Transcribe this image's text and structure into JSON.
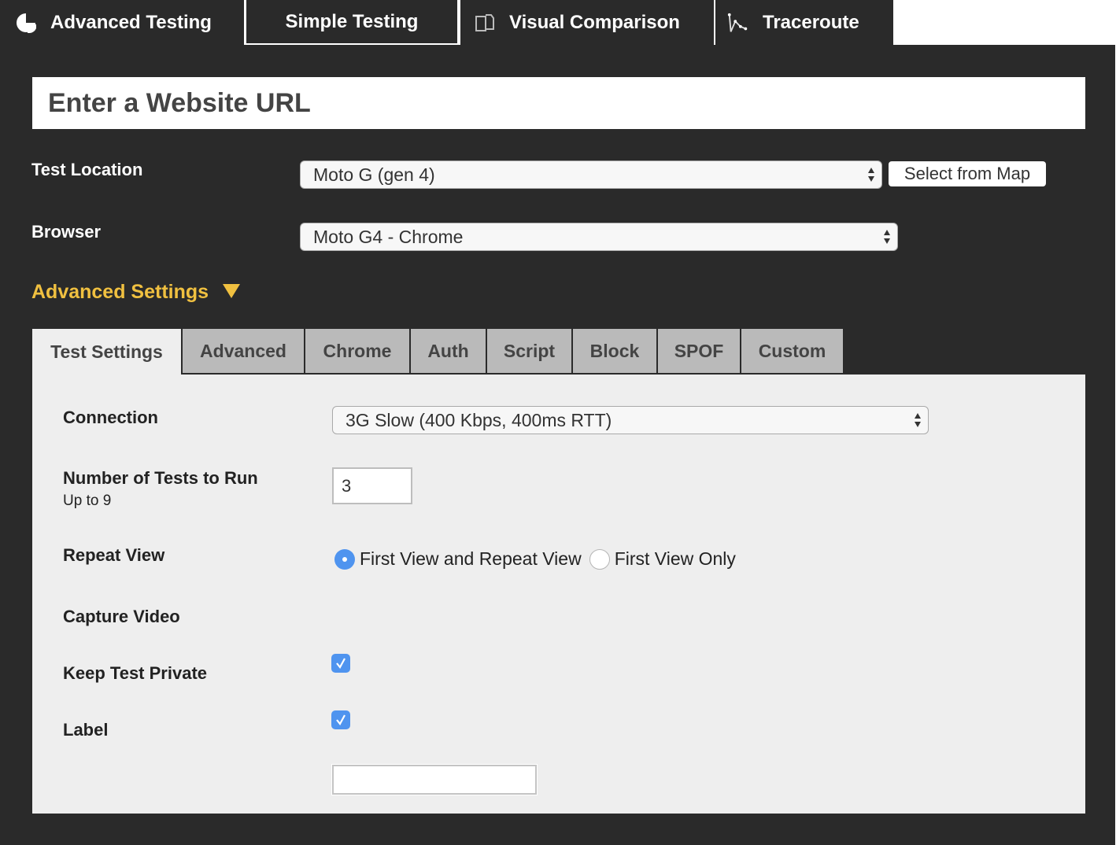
{
  "nav": {
    "tabs": [
      {
        "label": "Advanced Testing",
        "icon": "webpagetest-logo-icon",
        "active": true
      },
      {
        "label": "Simple Testing",
        "icon": null,
        "active": false
      },
      {
        "label": "Visual Comparison",
        "icon": "pages-icon",
        "active": false
      },
      {
        "label": "Traceroute",
        "icon": "traceroute-icon",
        "active": false
      }
    ]
  },
  "url": {
    "placeholder": "Enter a Website URL",
    "value": ""
  },
  "test_location": {
    "label": "Test Location",
    "selected": "Moto G (gen 4)",
    "map_button": "Select from Map"
  },
  "browser": {
    "label": "Browser",
    "selected": "Moto G4 - Chrome"
  },
  "advanced_settings": {
    "label": "Advanced Settings",
    "expanded": true,
    "accent_color": "#f0c040"
  },
  "settings_tabs": [
    {
      "label": "Test Settings",
      "active": true
    },
    {
      "label": "Advanced",
      "active": false
    },
    {
      "label": "Chrome",
      "active": false
    },
    {
      "label": "Auth",
      "active": false
    },
    {
      "label": "Script",
      "active": false
    },
    {
      "label": "Block",
      "active": false
    },
    {
      "label": "SPOF",
      "active": false
    },
    {
      "label": "Custom",
      "active": false
    }
  ],
  "test_settings": {
    "connection": {
      "label": "Connection",
      "selected": "3G Slow (400 Kbps, 400ms RTT)"
    },
    "num_tests": {
      "label": "Number of Tests to Run",
      "hint": "Up to 9",
      "value": "3"
    },
    "repeat_view": {
      "label": "Repeat View",
      "options": [
        {
          "label": "First View and Repeat View",
          "selected": true
        },
        {
          "label": "First View Only",
          "selected": false
        }
      ]
    },
    "capture_video": {
      "label": "Capture Video",
      "checked": true
    },
    "keep_private": {
      "label": "Keep Test Private",
      "checked": true
    },
    "test_label": {
      "label": "Label",
      "value": ""
    }
  },
  "colors": {
    "background": "#2a2a2a",
    "checkbox_blue": "#4f94ef",
    "tab_inactive": "#bababa",
    "panel": "#eeeeee"
  }
}
